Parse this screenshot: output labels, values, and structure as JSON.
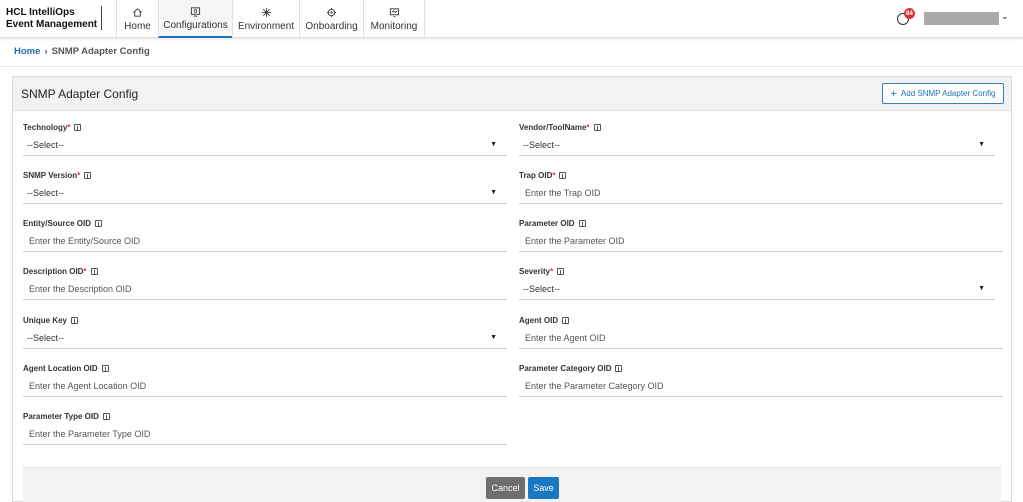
{
  "brand": {
    "line1": "HCL IntelliOps",
    "line2": "Event Management"
  },
  "nav": [
    {
      "label": "Home",
      "icon": "home-icon"
    },
    {
      "label": "Configurations",
      "icon": "configurations-icon",
      "active": true
    },
    {
      "label": "Environment",
      "icon": "environment-icon"
    },
    {
      "label": "Onboarding",
      "icon": "onboarding-icon"
    },
    {
      "label": "Monitoring",
      "icon": "monitoring-icon"
    }
  ],
  "alerts": {
    "count": "84",
    "badge_color": "#d9363e"
  },
  "breadcrumb": {
    "home": "Home",
    "separator": "›",
    "current": "SNMP Adapter Config"
  },
  "card": {
    "title": "SNMP Adapter Config",
    "add_button": "Add SNMP Adapter Config"
  },
  "fields": {
    "technology": {
      "label": "Technology",
      "required": "*",
      "value": "--Select--"
    },
    "vendor": {
      "label": "Vendor/ToolName",
      "required": "*",
      "value": "--Select--"
    },
    "snmp_version": {
      "label": "SNMP Version",
      "required": "*",
      "value": "--Select--"
    },
    "trap_oid": {
      "label": "Trap OID",
      "required": "*",
      "placeholder": "Enter the Trap OID"
    },
    "entity_oid": {
      "label": "Entity/Source OID",
      "placeholder": "Enter the Entity/Source OID"
    },
    "parameter_oid": {
      "label": "Parameter OID",
      "placeholder": "Enter the Parameter OID"
    },
    "description_oid": {
      "label": "Description OID",
      "required": "*",
      "placeholder": "Enter the Description OID"
    },
    "severity": {
      "label": "Severity",
      "required": "*",
      "value": "--Select--"
    },
    "unique_key": {
      "label": "Unique Key",
      "value": "--Select--"
    },
    "agent_oid": {
      "label": "Agent OID",
      "placeholder": "Enter the Agent OID"
    },
    "agent_location_oid": {
      "label": "Agent Location OID",
      "placeholder": "Enter the Agent Location OID"
    },
    "parameter_category_oid": {
      "label": "Parameter Category OID",
      "placeholder": "Enter the Parameter Category OID"
    },
    "parameter_type_oid": {
      "label": "Parameter Type OID",
      "placeholder": "Enter the Parameter Type OID"
    }
  },
  "footer": {
    "cancel": "Cancel",
    "save": "Save"
  },
  "colors": {
    "accent": "#1f6fb2",
    "save": "#1a78c2",
    "cancel": "#6e6e6e"
  }
}
